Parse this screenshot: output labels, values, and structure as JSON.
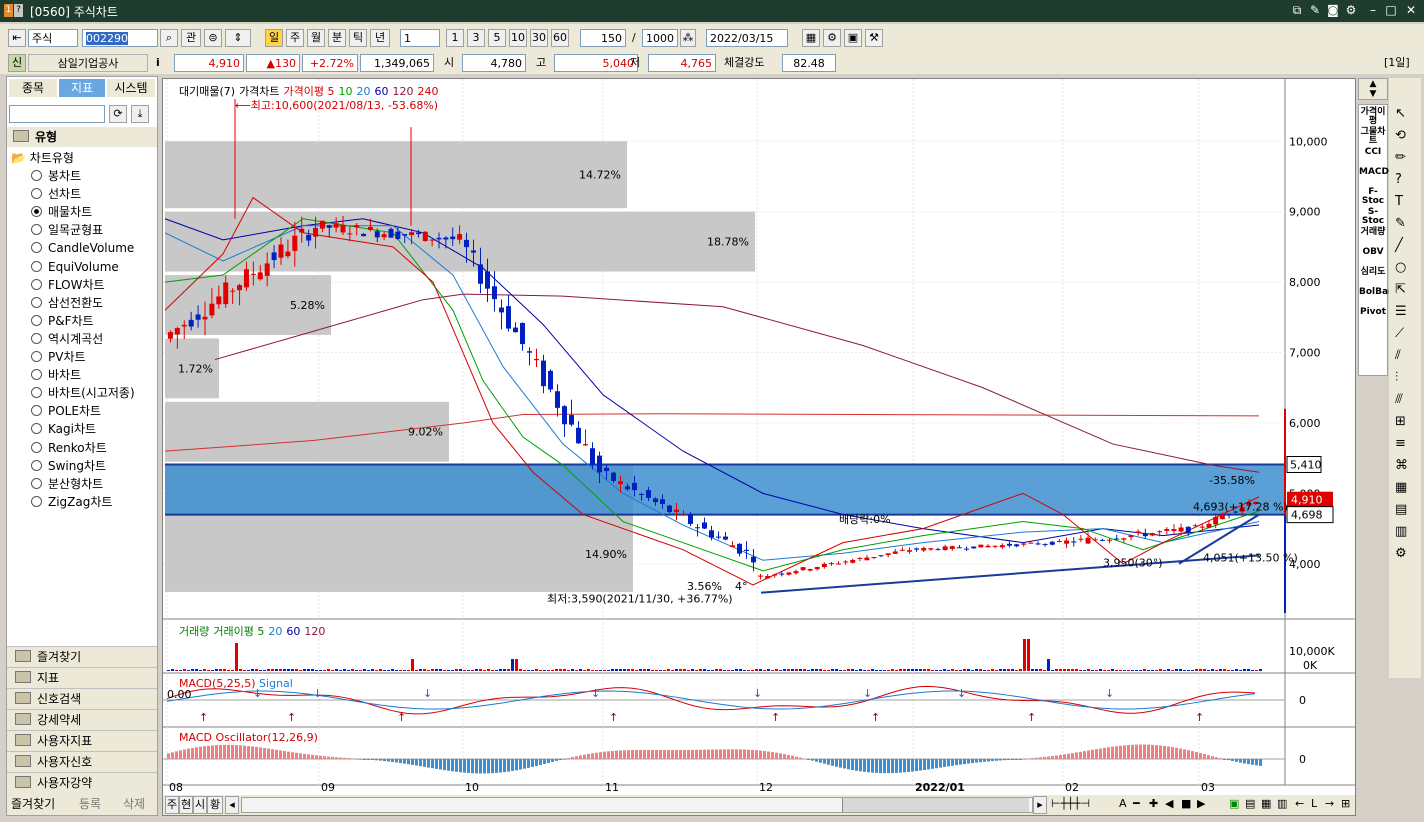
{
  "window": {
    "title": "[0560] 주식차트",
    "badges": [
      "1",
      "?"
    ]
  },
  "toolbar": {
    "market": "주식",
    "code": "002290",
    "gwan": "관",
    "periods": [
      "일",
      "주",
      "월",
      "분",
      "틱",
      "년"
    ],
    "unit": "1",
    "steps": [
      "1",
      "3",
      "5",
      "10",
      "30",
      "60"
    ],
    "count": "150",
    "total": "1000",
    "date": "2022/03/15"
  },
  "quote": {
    "badge": "신",
    "name": "삼일기업공사",
    "info": "i",
    "price": "4,910",
    "change": "▲130",
    "pct": "+2.72%",
    "volume": "1,349,065",
    "open_label": "시",
    "open": "4,780",
    "high_label": "고",
    "high": "5,040",
    "low_label": "저",
    "low": "4,765",
    "strength_label": "체결강도",
    "strength": "82.48",
    "period_badge": "[1일]"
  },
  "left": {
    "tabs": [
      "종목",
      "지표",
      "시스템"
    ],
    "section": "유형",
    "folder": "차트유형",
    "types": [
      "봉차트",
      "선차트",
      "매물차트",
      "일목균형표",
      "CandleVolume",
      "EquiVolume",
      "FLOW차트",
      "삼선전환도",
      "P&F차트",
      "역시계곡선",
      "PV차트",
      "바차트",
      "바차트(시고저종)",
      "POLE차트",
      "Kagi차트",
      "Renko차트",
      "Swing차트",
      "분산형차트",
      "ZigZag차트"
    ],
    "selected": 2,
    "accordion": [
      "즐겨찾기",
      "지표",
      "신호검색",
      "강세약세",
      "사용자지표",
      "사용자신호",
      "사용자강약"
    ],
    "bottom_tabs": [
      "즐겨찾기",
      "등록",
      "삭제"
    ]
  },
  "chart_legend": {
    "items": [
      "대기매물(7)",
      "가격차트",
      "가격이평 5",
      "10",
      "20",
      "60",
      "120",
      "240"
    ],
    "colors": [
      "#000000",
      "#000000",
      "#d40000",
      "#00a000",
      "#1a7ad4",
      "#0000aa",
      "#8b1a3a",
      "#d40000"
    ]
  },
  "annotations": {
    "high": "⟵최고:10,600(2021/08/13, -53.68%)",
    "low": "최저:3,590(2021/11/30, +36.77%)",
    "dividend": "배당락:0%",
    "t1": "-35.58%",
    "t2": "4,693(+17.28 %)",
    "t3": "3,950(30°)",
    "t4": "4,051(+13.50 %)",
    "t5": "3.56%",
    "t6": "4°"
  },
  "supply_bars": [
    {
      "label": "14.72%"
    },
    {
      "label": "18.78%"
    },
    {
      "label": "5.28%"
    },
    {
      "label": "1.72%"
    },
    {
      "label": "9.02%"
    },
    {
      "label": "14.90%"
    }
  ],
  "price_axis": {
    "ticks": [
      "10,000",
      "9,000",
      "8,000",
      "7,000",
      "6,000",
      "5,000",
      "4,000"
    ],
    "line_5410": "5,410",
    "current": "4,910",
    "level_4698": "4,698"
  },
  "volume_panel": {
    "legend": [
      "거래량",
      "거래이평 5",
      "20",
      "60",
      "120"
    ],
    "ticks": [
      "10,000K",
      "0K"
    ]
  },
  "macd_panel": {
    "legend": [
      "MACD(5,25,5)",
      "Signal"
    ],
    "value": "0.00",
    "tick": "0"
  },
  "osc_panel": {
    "legend": [
      "MACD Oscillator(12,26,9)"
    ],
    "tick": "0"
  },
  "x_axis": [
    "08",
    "09",
    "10",
    "11",
    "12",
    "2022/01",
    "02",
    "03"
  ],
  "bottom_buttons": [
    "주",
    "현",
    "시",
    "황"
  ],
  "right_tools": [
    "가격이평",
    "그물차트",
    "CCI",
    "MACD",
    "F-Stoc",
    "S-Stoc",
    "거래량",
    "OBV",
    "심리도",
    "BolBand",
    "Pivot"
  ],
  "chart_data": {
    "type": "candlestick",
    "categories": [
      "08",
      "09",
      "10",
      "11",
      "12",
      "2022/01",
      "02",
      "03"
    ],
    "ylim": [
      3500,
      10600
    ],
    "series": [
      {
        "name": "가격차트",
        "values": [
          {
            "month": "08",
            "open": 7200,
            "high": 10600,
            "low": 7000,
            "close": 8800
          },
          {
            "month": "09",
            "open": 8800,
            "high": 10200,
            "low": 8000,
            "close": 8600
          },
          {
            "month": "10",
            "open": 8600,
            "high": 8700,
            "low": 4900,
            "close": 5300
          },
          {
            "month": "11",
            "open": 5300,
            "high": 5600,
            "low": 3590,
            "close": 4100
          },
          {
            "month": "12",
            "open": 3800,
            "high": 4400,
            "low": 3700,
            "close": 4200
          },
          {
            "month": "2022/01",
            "open": 4200,
            "high": 4700,
            "low": 4100,
            "close": 4300
          },
          {
            "month": "02",
            "open": 4300,
            "high": 5100,
            "low": 3900,
            "close": 4500
          },
          {
            "month": "03",
            "open": 4500,
            "high": 5040,
            "low": 4000,
            "close": 4910
          }
        ]
      }
    ]
  }
}
